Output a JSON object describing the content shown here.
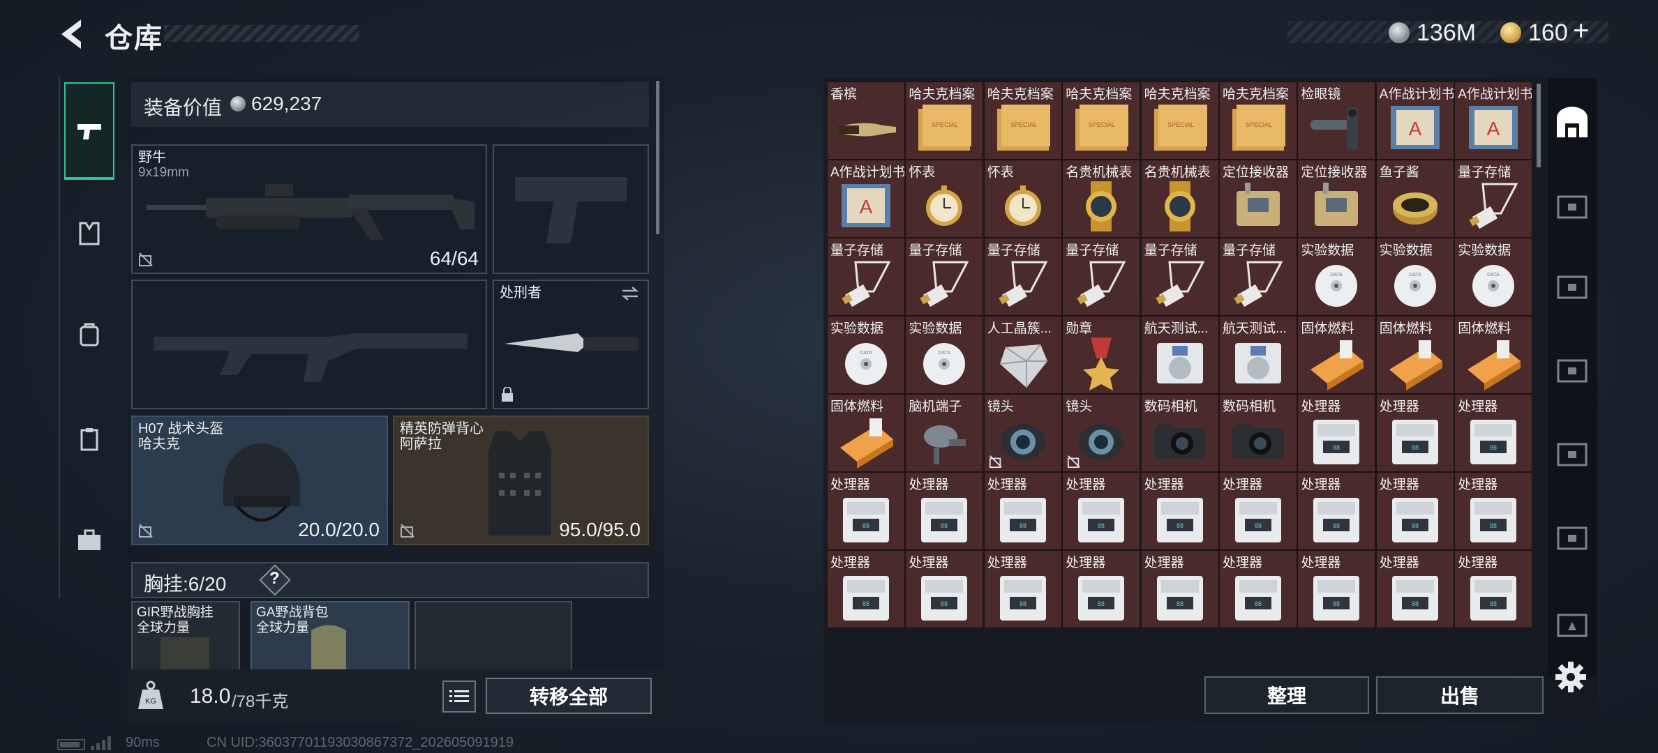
{
  "header": {
    "title": "仓库",
    "currency_silver": "136M",
    "currency_gold": "160",
    "currency_plus": "+"
  },
  "equipment": {
    "value_label": "装备价值",
    "value": "629,237",
    "primary_weapon": {
      "name": "野牛",
      "ammo": "9x19mm",
      "count": "64/64"
    },
    "melee": {
      "name": "处刑者"
    },
    "helmet": {
      "name": "H07 战术头盔",
      "faction": "哈夫克",
      "durability": "20.0/20.0"
    },
    "armor": {
      "name": "精英防弹背心",
      "faction": "阿萨拉",
      "durability": "95.0/95.0"
    },
    "chest_label": "胸挂:",
    "chest_count": "6/20",
    "chest_help": "?",
    "rig": {
      "name": "GIR野战胸挂",
      "faction": "全球力量"
    },
    "backpack": {
      "name": "GA野战背包",
      "faction": "全球力量"
    },
    "weight": "18.0",
    "weight_max": "/78千克",
    "transfer_all": "转移全部"
  },
  "warehouse": {
    "sort_label": "整理",
    "sell_label": "出售",
    "items": [
      {
        "name": "香槟",
        "icon": "champagne-icon",
        "bg": "#4a2a2a"
      },
      {
        "name": "哈夫克档案",
        "icon": "folder-icon",
        "bg": "#4a2a2a"
      },
      {
        "name": "哈夫克档案",
        "icon": "folder-icon",
        "bg": "#4a2a2a"
      },
      {
        "name": "哈夫克档案",
        "icon": "folder-icon",
        "bg": "#4a2a2a"
      },
      {
        "name": "哈夫克档案",
        "icon": "folder-icon",
        "bg": "#4a2a2a"
      },
      {
        "name": "哈夫克档案",
        "icon": "folder-icon",
        "bg": "#4a2a2a"
      },
      {
        "name": "检眼镜",
        "icon": "ophthalmoscope-icon",
        "bg": "#4a2a2a"
      },
      {
        "name": "A作战计划书",
        "icon": "plan-book-icon",
        "bg": "#4a2a2a"
      },
      {
        "name": "A作战计划书",
        "icon": "plan-book-icon",
        "bg": "#4a2a2a"
      },
      {
        "name": "A作战计划书",
        "icon": "plan-book-icon",
        "bg": "#4a2a2a"
      },
      {
        "name": "怀表",
        "icon": "pocket-watch-icon",
        "bg": "#4a2a2a"
      },
      {
        "name": "怀表",
        "icon": "pocket-watch-icon",
        "bg": "#4a2a2a"
      },
      {
        "name": "名贵机械表",
        "icon": "luxury-watch-icon",
        "bg": "#4a2a2a"
      },
      {
        "name": "名贵机械表",
        "icon": "luxury-watch-icon",
        "bg": "#4a2a2a"
      },
      {
        "name": "定位接收器",
        "icon": "locator-icon",
        "bg": "#4a2a2a"
      },
      {
        "name": "定位接收器",
        "icon": "locator-icon",
        "bg": "#4a2a2a"
      },
      {
        "name": "鱼子酱",
        "icon": "caviar-icon",
        "bg": "#4a2a2a"
      },
      {
        "name": "量子存储",
        "icon": "quantum-storage-icon",
        "bg": "#4a2a2a"
      },
      {
        "name": "量子存储",
        "icon": "quantum-storage-icon",
        "bg": "#4a2a2a"
      },
      {
        "name": "量子存储",
        "icon": "quantum-storage-icon",
        "bg": "#4a2a2a"
      },
      {
        "name": "量子存储",
        "icon": "quantum-storage-icon",
        "bg": "#4a2a2a"
      },
      {
        "name": "量子存储",
        "icon": "quantum-storage-icon",
        "bg": "#4a2a2a"
      },
      {
        "name": "量子存储",
        "icon": "quantum-storage-icon",
        "bg": "#4a2a2a"
      },
      {
        "name": "量子存储",
        "icon": "quantum-storage-icon",
        "bg": "#4a2a2a"
      },
      {
        "name": "实验数据",
        "icon": "disc-icon",
        "bg": "#4a2a2a"
      },
      {
        "name": "实验数据",
        "icon": "disc-icon",
        "bg": "#4a2a2a"
      },
      {
        "name": "实验数据",
        "icon": "disc-icon",
        "bg": "#4a2a2a"
      },
      {
        "name": "实验数据",
        "icon": "disc-icon",
        "bg": "#4a2a2a"
      },
      {
        "name": "实验数据",
        "icon": "disc-icon",
        "bg": "#4a2a2a"
      },
      {
        "name": "人工晶簇...",
        "icon": "crystal-icon",
        "bg": "#4a2a2a"
      },
      {
        "name": "勋章",
        "icon": "medal-icon",
        "bg": "#4a2a2a"
      },
      {
        "name": "航天测试...",
        "icon": "aerospace-test-icon",
        "bg": "#4a2a2a"
      },
      {
        "name": "航天测试...",
        "icon": "aerospace-test-icon",
        "bg": "#4a2a2a"
      },
      {
        "name": "固体燃料",
        "icon": "solid-fuel-icon",
        "bg": "#4a2a2a"
      },
      {
        "name": "固体燃料",
        "icon": "solid-fuel-icon",
        "bg": "#4a2a2a"
      },
      {
        "name": "固体燃料",
        "icon": "solid-fuel-icon",
        "bg": "#4a2a2a"
      },
      {
        "name": "固体燃料",
        "icon": "solid-fuel-icon",
        "bg": "#4a2a2a"
      },
      {
        "name": "脑机端子",
        "icon": "brain-terminal-icon",
        "bg": "#4a2a2a"
      },
      {
        "name": "镜头",
        "icon": "lens-icon",
        "bg": "#4a2a2a",
        "locked": true
      },
      {
        "name": "镜头",
        "icon": "lens-icon",
        "bg": "#4a2a2a",
        "locked": true
      },
      {
        "name": "数码相机",
        "icon": "camera-icon",
        "bg": "#4a2a2a"
      },
      {
        "name": "数码相机",
        "icon": "camera-icon",
        "bg": "#4a2a2a"
      },
      {
        "name": "处理器",
        "icon": "processor-icon",
        "bg": "#4a2a2a"
      },
      {
        "name": "处理器",
        "icon": "processor-icon",
        "bg": "#4a2a2a"
      },
      {
        "name": "处理器",
        "icon": "processor-icon",
        "bg": "#4a2a2a"
      },
      {
        "name": "处理器",
        "icon": "processor-icon",
        "bg": "#4a2a2a"
      },
      {
        "name": "处理器",
        "icon": "processor-icon",
        "bg": "#4a2a2a"
      },
      {
        "name": "处理器",
        "icon": "processor-icon",
        "bg": "#4a2a2a"
      },
      {
        "name": "处理器",
        "icon": "processor-icon",
        "bg": "#4a2a2a"
      },
      {
        "name": "处理器",
        "icon": "processor-icon",
        "bg": "#4a2a2a"
      },
      {
        "name": "处理器",
        "icon": "processor-icon",
        "bg": "#4a2a2a"
      },
      {
        "name": "处理器",
        "icon": "processor-icon",
        "bg": "#4a2a2a"
      },
      {
        "name": "处理器",
        "icon": "processor-icon",
        "bg": "#4a2a2a"
      },
      {
        "name": "处理器",
        "icon": "processor-icon",
        "bg": "#4a2a2a"
      },
      {
        "name": "处理器",
        "icon": "processor-icon",
        "bg": "#4a2a2a"
      },
      {
        "name": "处理器",
        "icon": "processor-icon",
        "bg": "#4a2a2a"
      },
      {
        "name": "处理器",
        "icon": "processor-icon",
        "bg": "#4a2a2a"
      },
      {
        "name": "处理器",
        "icon": "processor-icon",
        "bg": "#4a2a2a"
      },
      {
        "name": "处理器",
        "icon": "processor-icon",
        "bg": "#4a2a2a"
      },
      {
        "name": "处理器",
        "icon": "processor-icon",
        "bg": "#4a2a2a"
      },
      {
        "name": "处理器",
        "icon": "processor-icon",
        "bg": "#4a2a2a"
      },
      {
        "name": "处理器",
        "icon": "processor-icon",
        "bg": "#4a2a2a"
      },
      {
        "name": "处理器",
        "icon": "processor-icon",
        "bg": "#4a2a2a"
      }
    ]
  },
  "status": {
    "ping": "90ms",
    "uid": "CN UID:36037701193030867372_202605091919"
  },
  "colors": {
    "accent": "#2ec49a",
    "rare_item_bg": "#4a2a2a",
    "helmet_bg": "#2c3b4e",
    "armor_bg": "#3a342c"
  }
}
